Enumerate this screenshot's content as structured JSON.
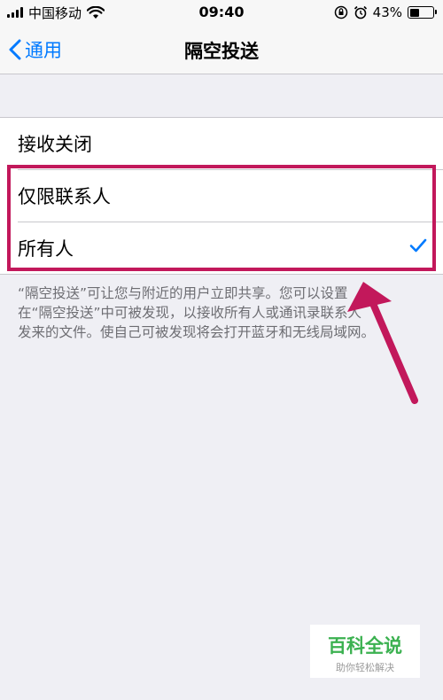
{
  "status_bar": {
    "carrier": "中国移动",
    "time": "09:40",
    "battery_percent": "43%",
    "battery_level": 0.43,
    "icons": [
      "signal-icon",
      "wifi-icon",
      "rotation-lock-icon",
      "alarm-icon",
      "battery-icon"
    ]
  },
  "nav": {
    "back_label": "通用",
    "title": "隔空投送"
  },
  "options": [
    {
      "label": "接收关闭",
      "selected": false
    },
    {
      "label": "仅限联系人",
      "selected": false
    },
    {
      "label": "所有人",
      "selected": true
    }
  ],
  "footer": {
    "line1": "“隔空投送”可让您与附近的用户立即共享。您可以设置",
    "line2": "在“隔空投送”中可被发现，以接收所有人或通讯录联系人",
    "line3": "发来的文件。使自己可被发现将会打开蓝牙和无线局域网。"
  },
  "annotation": {
    "color": "#C2185B"
  },
  "watermark": {
    "main": "百科全说",
    "sub": "助你轻松解决"
  },
  "colors": {
    "accent": "#007AFF",
    "background": "#EFEFF4",
    "watermark_green": "#3BB150"
  }
}
